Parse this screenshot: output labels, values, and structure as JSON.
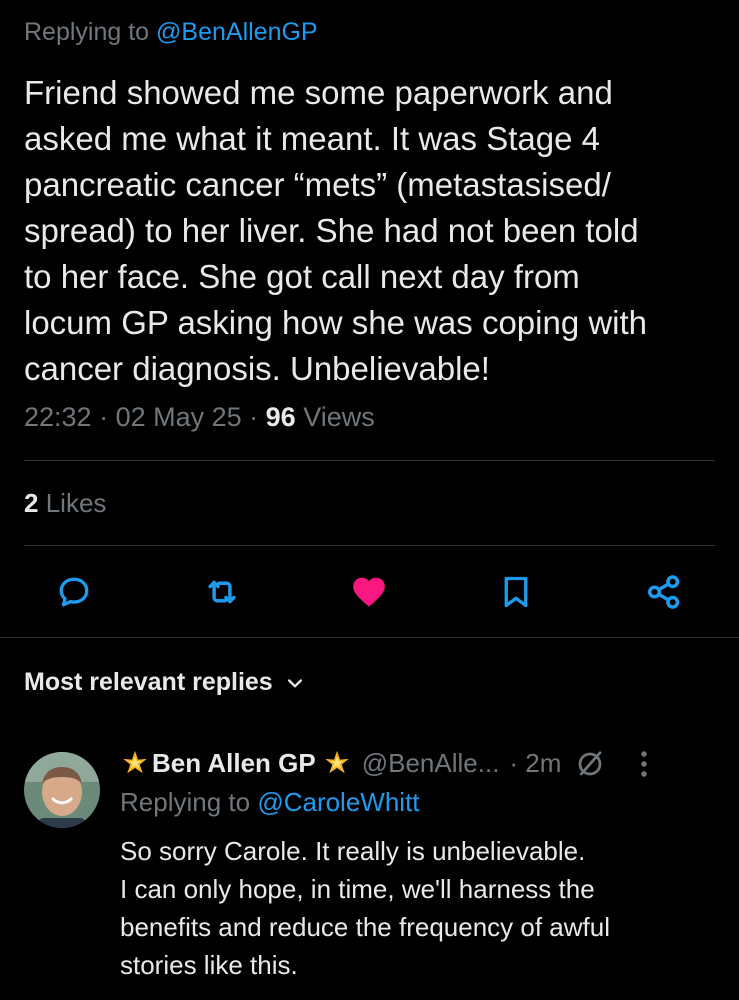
{
  "tweet": {
    "replying_prefix": "Replying to ",
    "replying_handle": "@BenAllenGP",
    "text_lines": [
      "Friend showed me some paperwork and",
      "asked me what it meant. It was Stage 4",
      "pancreatic cancer “mets” (metastasised/",
      "spread) to her liver. She had not been told",
      "to her face. She got call next day from",
      "locum GP asking how she was coping with",
      "cancer diagnosis. Unbelievable!"
    ],
    "time": "22:32",
    "date": "02 May 25",
    "views_count": "96",
    "views_label": "Views",
    "likes_count": "2",
    "likes_label": "Likes"
  },
  "actions": {
    "reply_icon": "reply-icon",
    "retweet_icon": "retweet-icon",
    "like_icon": "heart-filled-icon",
    "bookmark_icon": "bookmark-icon",
    "share_icon": "share-icon"
  },
  "replies_section": {
    "title": "Most relevant replies"
  },
  "reply": {
    "display_name": "Ben Allen GP",
    "handle": "@BenAlle...",
    "time": "· 2m",
    "replying_prefix": "Replying to ",
    "replying_handle": "@CaroleWhitt",
    "text_lines": [
      "So sorry Carole. It really is unbelievable.",
      "I can only hope, in time, we'll harness the",
      "benefits and reduce the frequency of awful",
      "stories like this."
    ]
  },
  "colors": {
    "background": "#000000",
    "text": "#e7e9ea",
    "muted": "#71767b",
    "accent": "#1d9bf0",
    "like": "#f91880",
    "divider": "#2f3336"
  }
}
